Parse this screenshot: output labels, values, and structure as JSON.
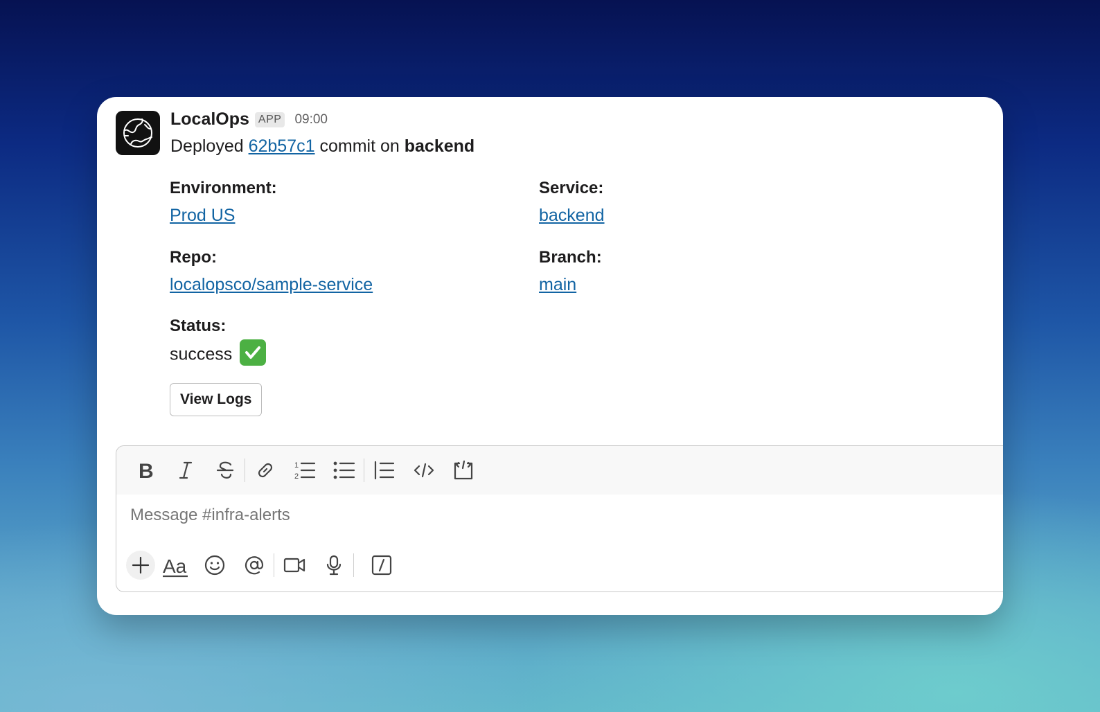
{
  "message": {
    "sender": "LocalOps",
    "badge": "APP",
    "time": "09:00",
    "prefix": "Deployed",
    "commit": "62b57c1",
    "middle": "commit on",
    "service_bold": "backend"
  },
  "fields": {
    "environment": {
      "label": "Environment:",
      "value": "Prod US"
    },
    "service": {
      "label": "Service:",
      "value": "backend"
    },
    "repo": {
      "label": "Repo:",
      "value": "localopsco/sample-service"
    },
    "branch": {
      "label": "Branch:",
      "value": "main"
    },
    "status": {
      "label": "Status:",
      "value": "success"
    }
  },
  "actions": {
    "view_logs": "View Logs"
  },
  "composer": {
    "placeholder": "Message #infra-alerts",
    "format_icons": [
      "bold-icon",
      "italic-icon",
      "strikethrough-icon",
      "link-icon",
      "ordered-list-icon",
      "bulleted-list-icon",
      "blockquote-icon",
      "code-icon",
      "code-block-icon"
    ],
    "bottom_icons": [
      "plus-icon",
      "formatting-icon",
      "emoji-icon",
      "mention-icon",
      "video-icon",
      "microphone-icon",
      "slash-command-icon"
    ]
  },
  "colors": {
    "link": "#1264a3",
    "success": "#4cb043"
  }
}
